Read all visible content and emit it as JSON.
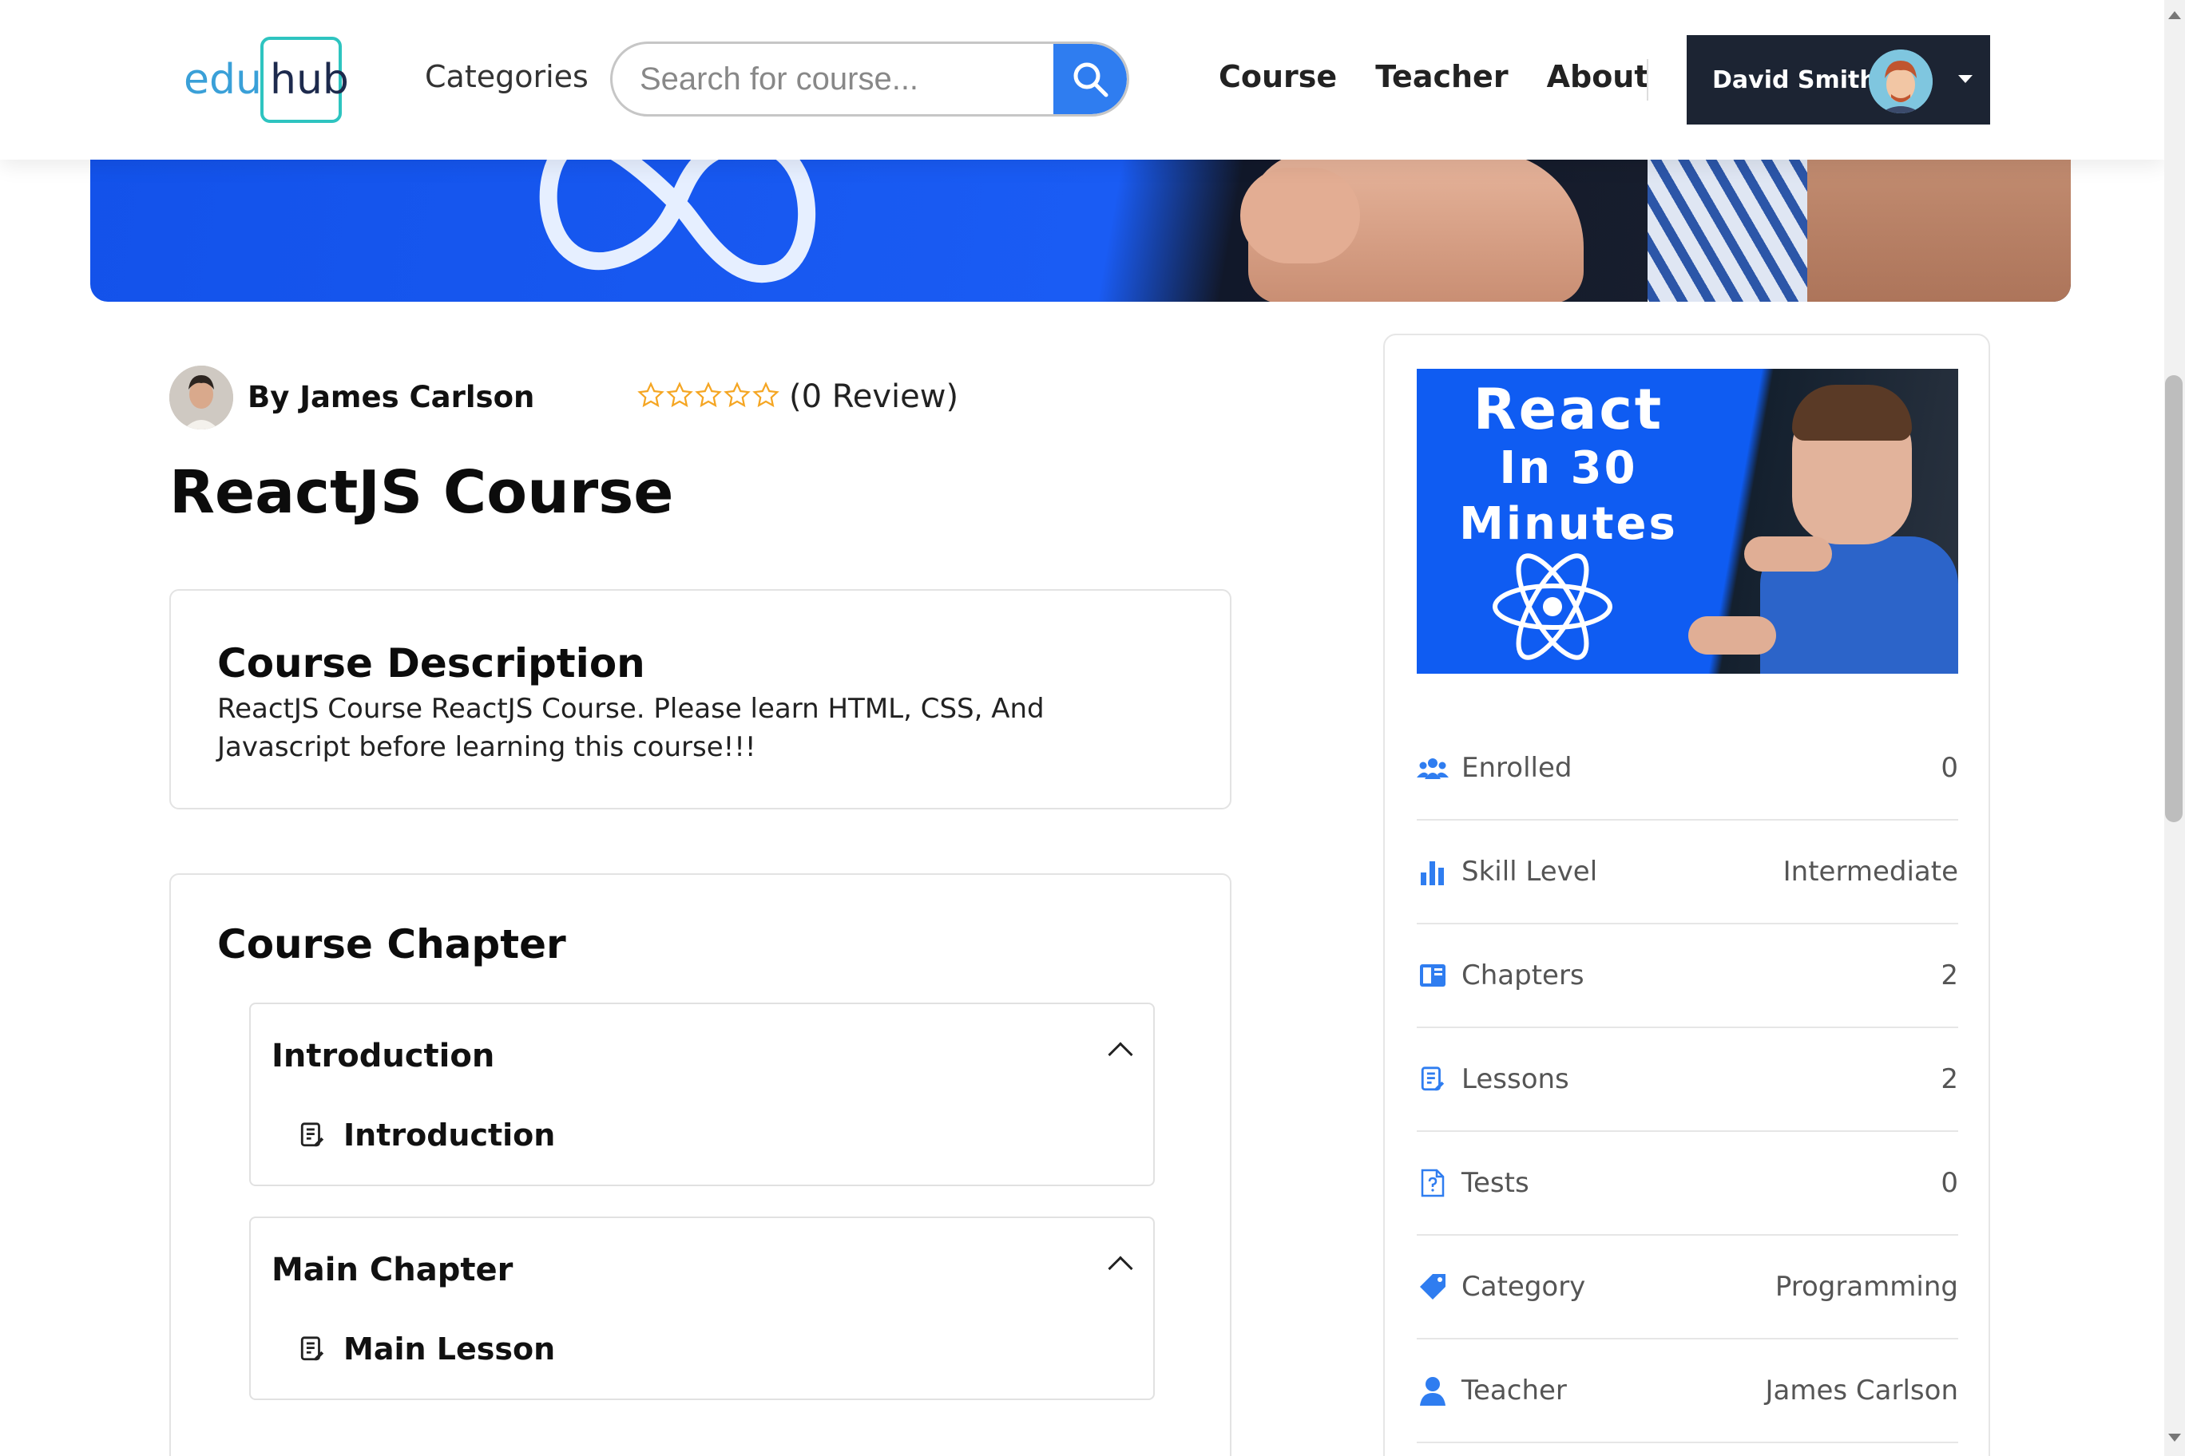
{
  "header": {
    "logo_part1": "edu",
    "logo_part2": "hub",
    "categories_label": "Categories",
    "search_placeholder": "Search for course...",
    "nav": [
      "Course",
      "Teacher",
      "About"
    ],
    "user_name": "David Smith"
  },
  "course": {
    "author": "By James Carlson",
    "rating_stars": 5,
    "rating_filled": 0,
    "review_text": "(0 Review)",
    "title": "ReactJS Course",
    "description_heading": "Course Description",
    "description": "ReactJS Course ReactJS Course. Please learn HTML, CSS, And Javascript before learning this course!!!",
    "chapter_heading": "Course Chapter",
    "chapters": [
      {
        "title": "Introduction",
        "lesson": "Introduction"
      },
      {
        "title": "Main Chapter",
        "lesson": "Main Lesson"
      }
    ]
  },
  "sidebar": {
    "thumbnail_lines": [
      "React",
      "In 30",
      "Minutes"
    ],
    "stats": [
      {
        "icon": "users-icon",
        "label": "Enrolled",
        "value": "0"
      },
      {
        "icon": "bar-chart-icon",
        "label": "Skill Level",
        "value": "Intermediate"
      },
      {
        "icon": "book-icon",
        "label": "Chapters",
        "value": "2"
      },
      {
        "icon": "document-icon",
        "label": "Lessons",
        "value": "2"
      },
      {
        "icon": "test-file-icon",
        "label": "Tests",
        "value": "0"
      },
      {
        "icon": "tag-icon",
        "label": "Category",
        "value": "Programming"
      },
      {
        "icon": "user-icon",
        "label": "Teacher",
        "value": "James Carlson"
      }
    ]
  },
  "colors": {
    "accent": "#2f7df0",
    "star": "#f5a623",
    "dark": "#1c2433"
  }
}
